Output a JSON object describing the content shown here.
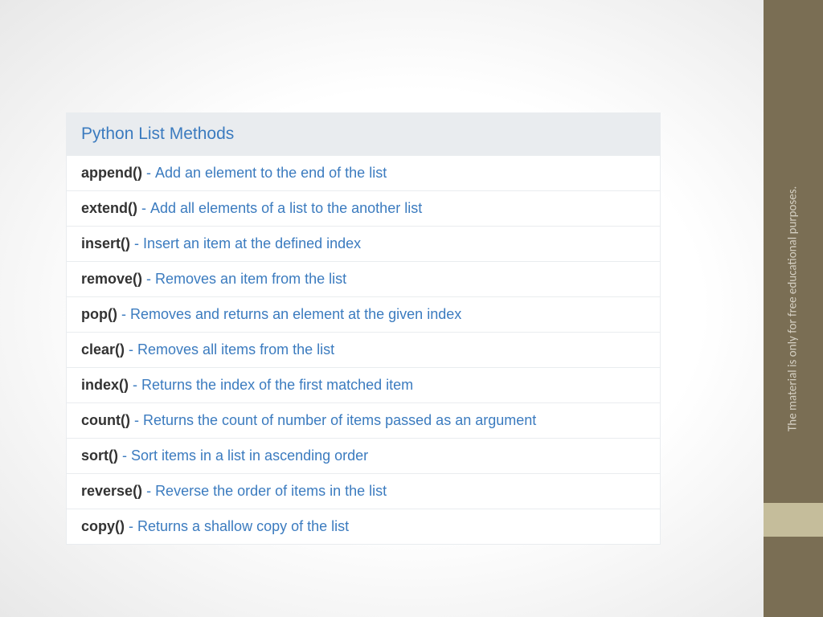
{
  "sidebar": {
    "note": "The material is only for free educational purposes."
  },
  "table": {
    "title": "Python List Methods",
    "separator": " - ",
    "rows": [
      {
        "method": "append()",
        "desc": "Add an element to the end of the list"
      },
      {
        "method": "extend()",
        "desc": "Add all elements of a list to the another list"
      },
      {
        "method": "insert()",
        "desc": "Insert an item at the defined index"
      },
      {
        "method": "remove()",
        "desc": "Removes an item from the list"
      },
      {
        "method": "pop()",
        "desc": "Removes and returns an element at the given index"
      },
      {
        "method": "clear()",
        "desc": "Removes all items from the list"
      },
      {
        "method": "index()",
        "desc": "Returns the index of the first matched item"
      },
      {
        "method": "count()",
        "desc": "Returns the count of number of items passed as an argument"
      },
      {
        "method": "sort()",
        "desc": "Sort items in a list in ascending order"
      },
      {
        "method": "reverse()",
        "desc": "Reverse the order of items in the list"
      },
      {
        "method": "copy()",
        "desc": "Returns a shallow copy of the list"
      }
    ]
  }
}
